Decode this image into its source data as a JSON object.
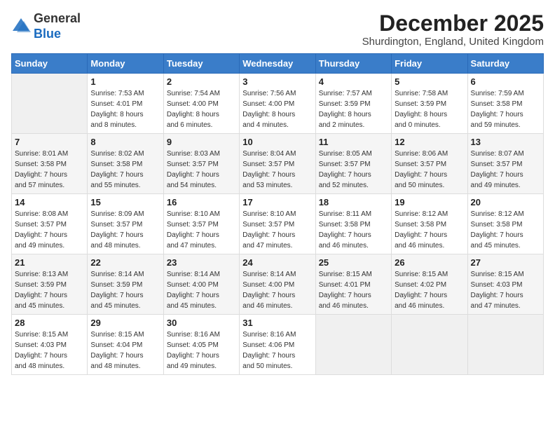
{
  "header": {
    "logo_line1": "General",
    "logo_line2": "Blue",
    "month_title": "December 2025",
    "subtitle": "Shurdington, England, United Kingdom"
  },
  "days_of_week": [
    "Sunday",
    "Monday",
    "Tuesday",
    "Wednesday",
    "Thursday",
    "Friday",
    "Saturday"
  ],
  "weeks": [
    [
      {
        "day": "",
        "empty": true
      },
      {
        "day": "1",
        "sunrise": "7:53 AM",
        "sunset": "4:01 PM",
        "daylight": "8 hours and 8 minutes."
      },
      {
        "day": "2",
        "sunrise": "7:54 AM",
        "sunset": "4:00 PM",
        "daylight": "8 hours and 6 minutes."
      },
      {
        "day": "3",
        "sunrise": "7:56 AM",
        "sunset": "4:00 PM",
        "daylight": "8 hours and 4 minutes."
      },
      {
        "day": "4",
        "sunrise": "7:57 AM",
        "sunset": "3:59 PM",
        "daylight": "8 hours and 2 minutes."
      },
      {
        "day": "5",
        "sunrise": "7:58 AM",
        "sunset": "3:59 PM",
        "daylight": "8 hours and 0 minutes."
      },
      {
        "day": "6",
        "sunrise": "7:59 AM",
        "sunset": "3:58 PM",
        "daylight": "7 hours and 59 minutes."
      }
    ],
    [
      {
        "day": "7",
        "sunrise": "8:01 AM",
        "sunset": "3:58 PM",
        "daylight": "7 hours and 57 minutes."
      },
      {
        "day": "8",
        "sunrise": "8:02 AM",
        "sunset": "3:58 PM",
        "daylight": "7 hours and 55 minutes."
      },
      {
        "day": "9",
        "sunrise": "8:03 AM",
        "sunset": "3:57 PM",
        "daylight": "7 hours and 54 minutes."
      },
      {
        "day": "10",
        "sunrise": "8:04 AM",
        "sunset": "3:57 PM",
        "daylight": "7 hours and 53 minutes."
      },
      {
        "day": "11",
        "sunrise": "8:05 AM",
        "sunset": "3:57 PM",
        "daylight": "7 hours and 52 minutes."
      },
      {
        "day": "12",
        "sunrise": "8:06 AM",
        "sunset": "3:57 PM",
        "daylight": "7 hours and 50 minutes."
      },
      {
        "day": "13",
        "sunrise": "8:07 AM",
        "sunset": "3:57 PM",
        "daylight": "7 hours and 49 minutes."
      }
    ],
    [
      {
        "day": "14",
        "sunrise": "8:08 AM",
        "sunset": "3:57 PM",
        "daylight": "7 hours and 49 minutes."
      },
      {
        "day": "15",
        "sunrise": "8:09 AM",
        "sunset": "3:57 PM",
        "daylight": "7 hours and 48 minutes."
      },
      {
        "day": "16",
        "sunrise": "8:10 AM",
        "sunset": "3:57 PM",
        "daylight": "7 hours and 47 minutes."
      },
      {
        "day": "17",
        "sunrise": "8:10 AM",
        "sunset": "3:57 PM",
        "daylight": "7 hours and 47 minutes."
      },
      {
        "day": "18",
        "sunrise": "8:11 AM",
        "sunset": "3:58 PM",
        "daylight": "7 hours and 46 minutes."
      },
      {
        "day": "19",
        "sunrise": "8:12 AM",
        "sunset": "3:58 PM",
        "daylight": "7 hours and 46 minutes."
      },
      {
        "day": "20",
        "sunrise": "8:12 AM",
        "sunset": "3:58 PM",
        "daylight": "7 hours and 45 minutes."
      }
    ],
    [
      {
        "day": "21",
        "sunrise": "8:13 AM",
        "sunset": "3:59 PM",
        "daylight": "7 hours and 45 minutes."
      },
      {
        "day": "22",
        "sunrise": "8:14 AM",
        "sunset": "3:59 PM",
        "daylight": "7 hours and 45 minutes."
      },
      {
        "day": "23",
        "sunrise": "8:14 AM",
        "sunset": "4:00 PM",
        "daylight": "7 hours and 45 minutes."
      },
      {
        "day": "24",
        "sunrise": "8:14 AM",
        "sunset": "4:00 PM",
        "daylight": "7 hours and 46 minutes."
      },
      {
        "day": "25",
        "sunrise": "8:15 AM",
        "sunset": "4:01 PM",
        "daylight": "7 hours and 46 minutes."
      },
      {
        "day": "26",
        "sunrise": "8:15 AM",
        "sunset": "4:02 PM",
        "daylight": "7 hours and 46 minutes."
      },
      {
        "day": "27",
        "sunrise": "8:15 AM",
        "sunset": "4:03 PM",
        "daylight": "7 hours and 47 minutes."
      }
    ],
    [
      {
        "day": "28",
        "sunrise": "8:15 AM",
        "sunset": "4:03 PM",
        "daylight": "7 hours and 48 minutes."
      },
      {
        "day": "29",
        "sunrise": "8:15 AM",
        "sunset": "4:04 PM",
        "daylight": "7 hours and 48 minutes."
      },
      {
        "day": "30",
        "sunrise": "8:16 AM",
        "sunset": "4:05 PM",
        "daylight": "7 hours and 49 minutes."
      },
      {
        "day": "31",
        "sunrise": "8:16 AM",
        "sunset": "4:06 PM",
        "daylight": "7 hours and 50 minutes."
      },
      {
        "day": "",
        "empty": true
      },
      {
        "day": "",
        "empty": true
      },
      {
        "day": "",
        "empty": true
      }
    ]
  ],
  "labels": {
    "sunrise_prefix": "Sunrise: ",
    "sunset_prefix": "Sunset: ",
    "daylight_prefix": "Daylight: "
  }
}
